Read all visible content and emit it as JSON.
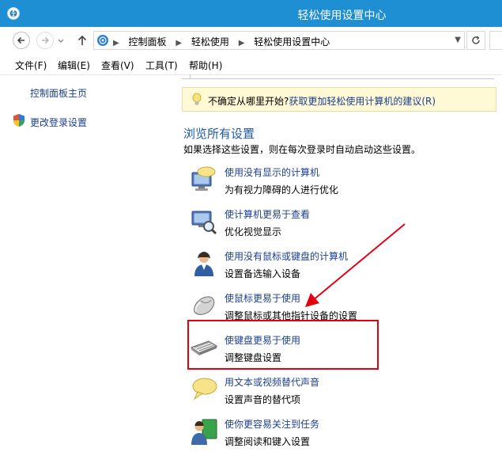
{
  "window": {
    "title": "轻松使用设置中心"
  },
  "address": {
    "crumbs": [
      "控制面板",
      "轻松使用",
      "轻松使用设置中心"
    ]
  },
  "menu": [
    "文件(F)",
    "编辑(E)",
    "查看(V)",
    "工具(T)",
    "帮助(H)"
  ],
  "sidebar": {
    "home_label": "控制面板主页",
    "login_label": "更改登录设置"
  },
  "tip": {
    "text": "不确定从哪里开始?",
    "link": "获取更加轻松使用计算机的建议(R)"
  },
  "section": {
    "title": "浏览所有设置",
    "subtitle": "如果选择这些设置，则在每次登录时自动启动这些设置。"
  },
  "items": [
    {
      "link": "使用没有显示的计算机",
      "desc": "为有视力障碍的人进行优化",
      "icon": "monitor-speech-icon"
    },
    {
      "link": "使计算机更易于查看",
      "desc": "优化视觉显示",
      "icon": "monitor-magnifier-icon"
    },
    {
      "link": "使用没有鼠标或键盘的计算机",
      "desc": "设置备选输入设备",
      "icon": "person-headset-icon"
    },
    {
      "link": "使鼠标更易于使用",
      "desc": "调整鼠标或其他指针设备的设置",
      "icon": "mouse-icon"
    },
    {
      "link": "使键盘更易于使用",
      "desc": "调整键盘设置",
      "icon": "keyboard-icon"
    },
    {
      "link": "用文本或视频替代声音",
      "desc": "设置声音的替代项",
      "icon": "speech-bubble-icon"
    },
    {
      "link": "使你更容易关注到任务",
      "desc": "调整阅读和键入设置",
      "icon": "person-board-icon"
    }
  ],
  "colors": {
    "titlebar": "#1e8fd2",
    "link": "#1b3f91",
    "heading": "#1e5aa8",
    "annotation": "#e3000f",
    "tip_bg": "#fff9d6"
  }
}
